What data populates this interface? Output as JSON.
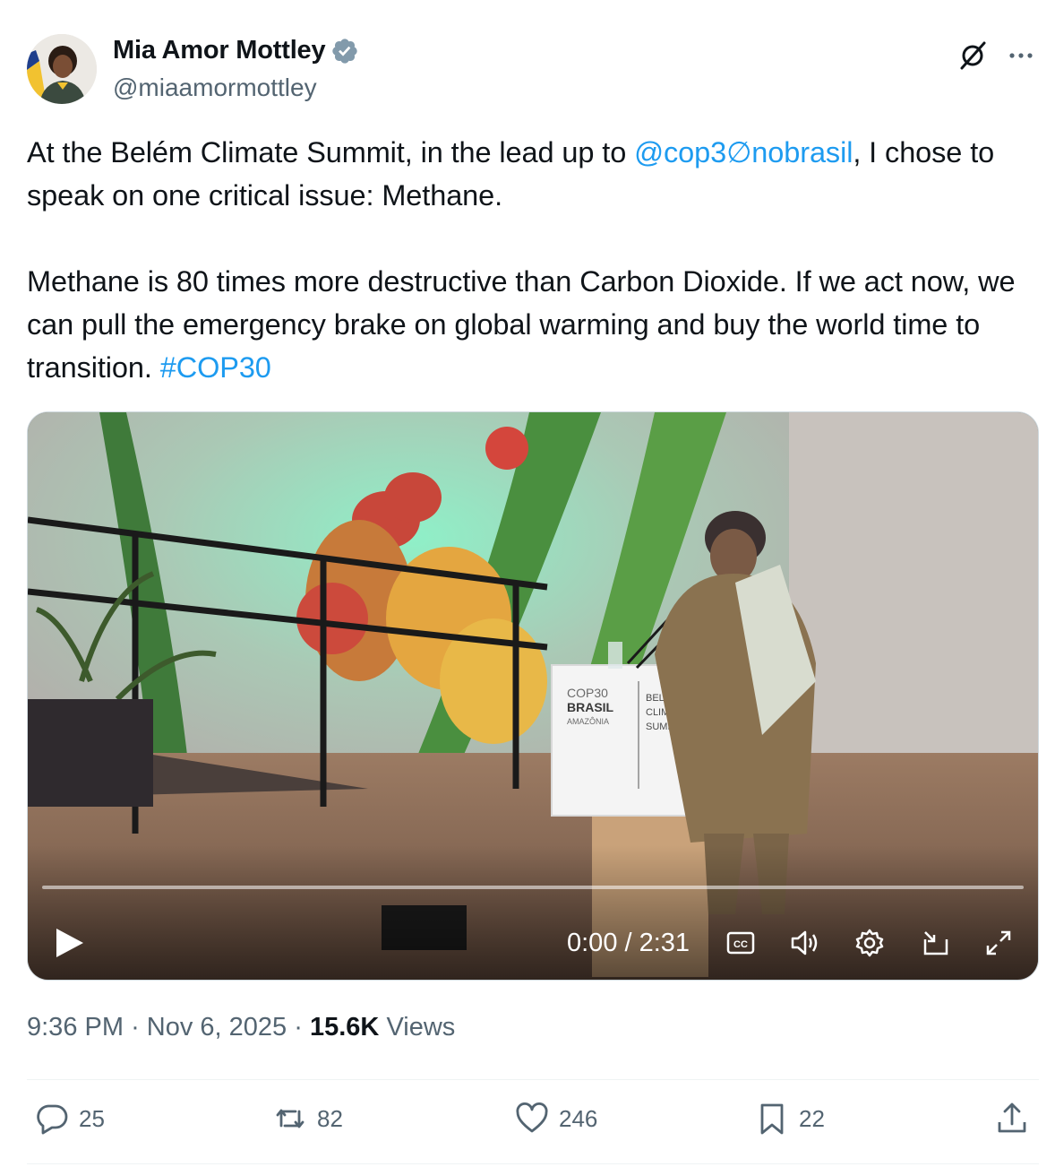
{
  "author": {
    "display_name": "Mia Amor Mottley",
    "handle": "@miaamormottley",
    "verified": true
  },
  "tweet": {
    "para1_pre": "At the Belém Climate Summit, in the lead up to ",
    "mention": "@cop3∅nobrasil",
    "para1_post": ", I chose to speak on one critical issue: Methane.",
    "para2_pre": "Methane is 80 times more destructive than Carbon Dioxide. If we act now, we can pull the emergency brake on global warming and buy the world time to transition. ",
    "hashtag": "#COP30"
  },
  "video": {
    "time_display": "0:00 / 2:31",
    "progress": 0,
    "podium_sign": {
      "left_lines": [
        "COP30",
        "BRASIL",
        "AMAZÔNIA"
      ],
      "right_lines": [
        "BELÉM",
        "CLIMATE",
        "SUMMIT"
      ]
    }
  },
  "meta": {
    "time": "9:36 PM",
    "sep": "·",
    "date": "Nov 6, 2025",
    "views_count": "15.6K",
    "views_label": "Views"
  },
  "actions": {
    "replies": "25",
    "reposts": "82",
    "likes": "246",
    "bookmarks": "22"
  },
  "colors": {
    "link": "#1d9bf0",
    "secondary_text": "#536471",
    "verified_badge": "#829aab"
  }
}
